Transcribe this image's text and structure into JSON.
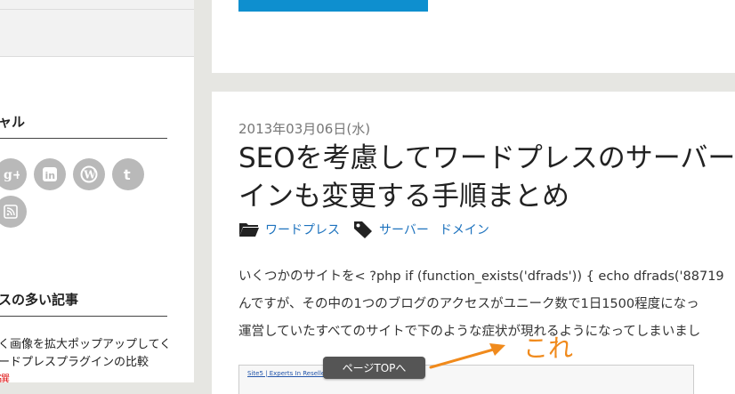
{
  "sidebar": {
    "social_heading": "ャル",
    "social_icons": [
      "google-plus-icon",
      "linkedin-icon",
      "wordpress-icon",
      "tumblr-icon",
      "rss-icon"
    ],
    "popular_heading": "スの多い記事",
    "popular_line1": "く画像を拡大ポップアップしてく",
    "popular_line2": "ードプレスプラグインの比較",
    "popular_line3": "選"
  },
  "article": {
    "date": "2013年03月06日(水)",
    "title_line1": "SEOを考慮してワードプレスのサーバーを",
    "title_line2": "インも変更する手順まとめ",
    "category": "ワードプレス",
    "tag1": "サーバー",
    "tag2": "ドメイン",
    "excerpt_line1": "いくつかのサイトを< ?php if (function_exists('dfrads')) { echo dfrads('88719",
    "excerpt_line2": "んですが、その中の1つのブログのアクセスがユニーク数で1日1500程度になっ",
    "excerpt_line3": "運営していたすべてのサイトで下のような症状が現れるようになってしまいまし",
    "screenshot_link": "Site5 | Experts In Reseller Hosting"
  },
  "page_top_label": "ページTOPへ",
  "annotation_text": "これ",
  "colors": {
    "accent_blue": "#0e8fcf",
    "link": "#1e73be",
    "annotation": "#f08a1c",
    "background": "#e6e6e2"
  }
}
